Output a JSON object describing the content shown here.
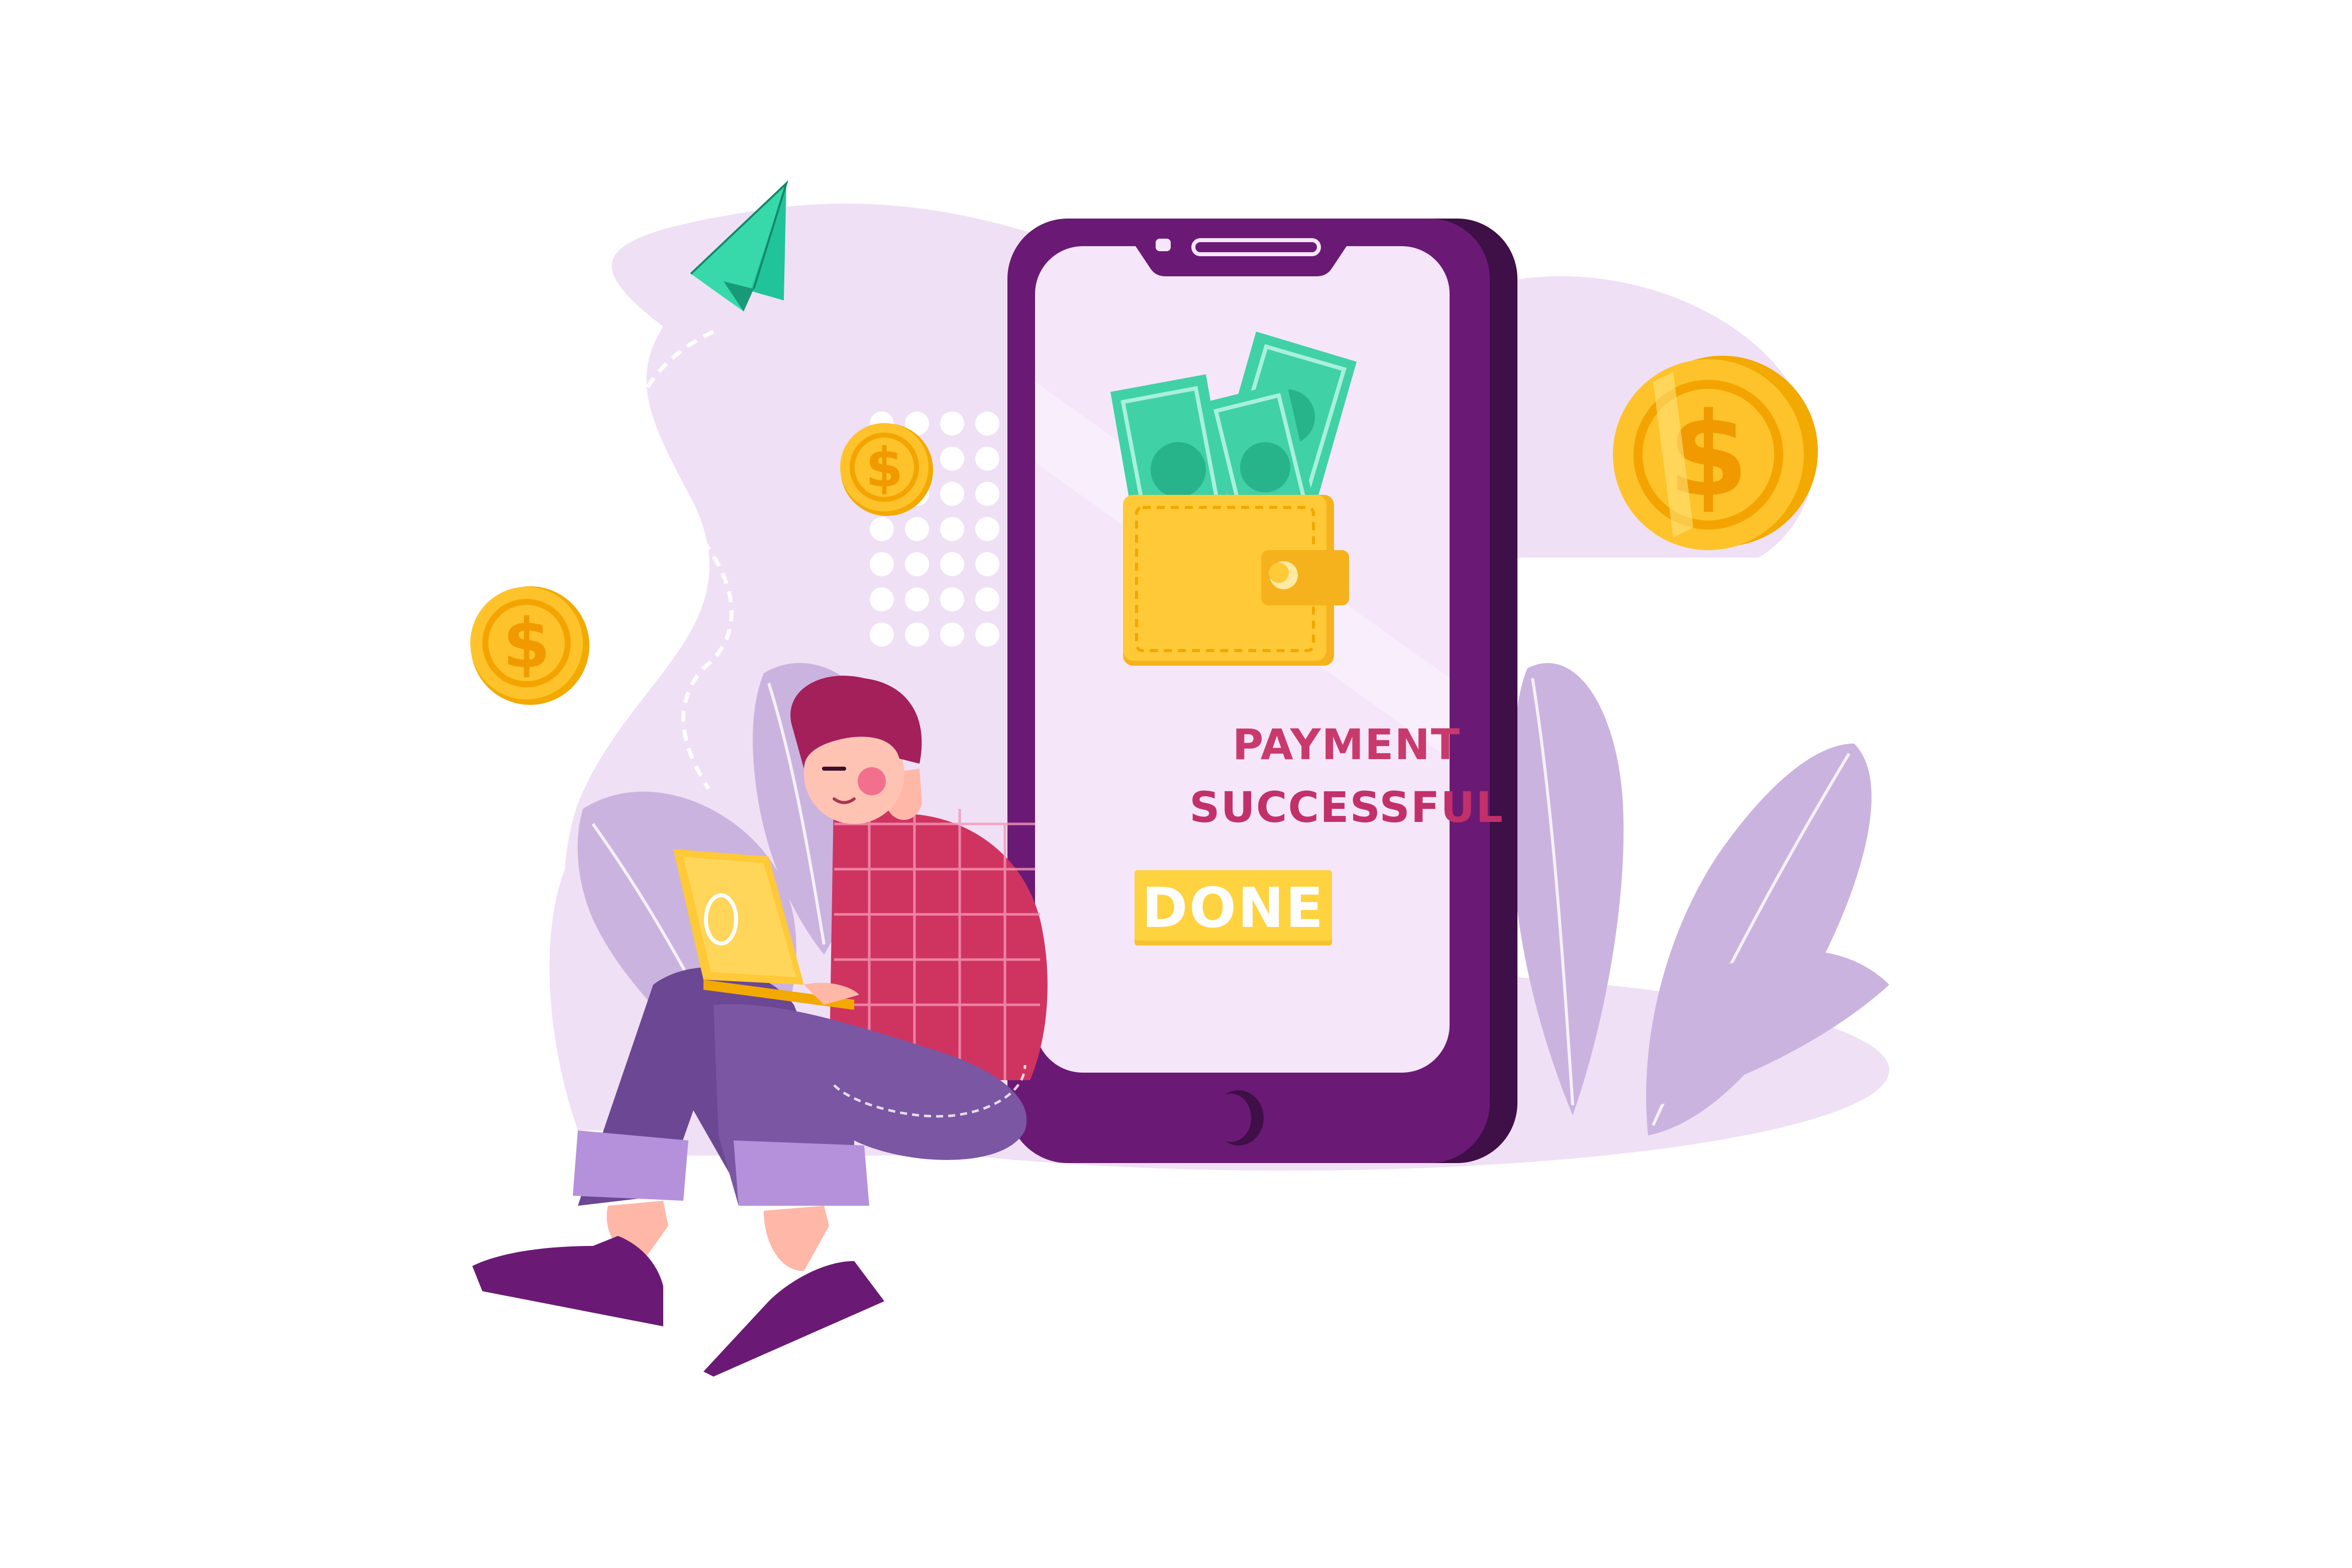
{
  "payment": {
    "status_line_1": "PAYMENT",
    "status_line_2": "SUCCESSFUL",
    "done_label": "DONE"
  },
  "colors": {
    "phone_body": "#6a1a74",
    "phone_screen": "#f6e6fa",
    "blob": "#efe0f5",
    "leaf": "#cbb3df",
    "coin": "#fec32a",
    "banknote": "#41d1a6",
    "wallet": "#ffc937",
    "shirt": "#cf3460",
    "pants": "#7b56a3",
    "paper_plane": "#21c49a",
    "status_text": "#c93a6c",
    "done_button": "#ffd23f"
  },
  "icons": [
    "paper-plane-icon",
    "dollar-coin-icon",
    "wallet-icon",
    "banknote-icon",
    "laptop-icon"
  ]
}
